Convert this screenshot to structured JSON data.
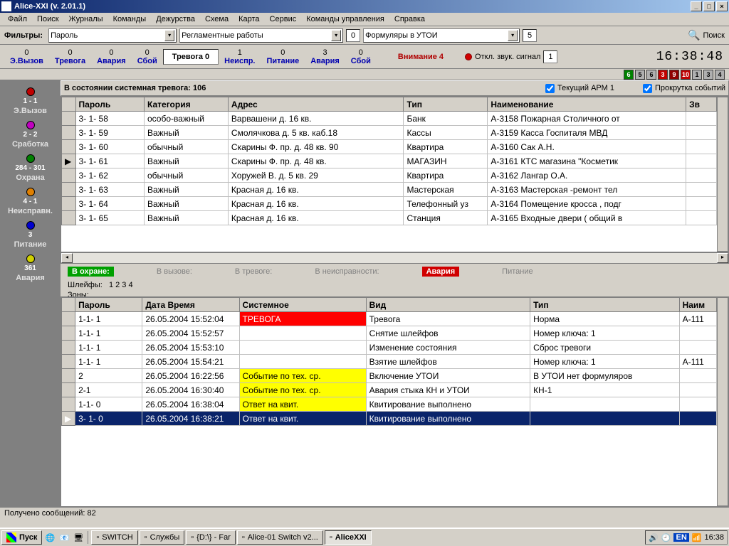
{
  "title": "Alice-XXI (v. 2.01.1)",
  "menu": [
    "Файл",
    "Поиск",
    "Журналы",
    "Команды",
    "Дежурства",
    "Схема",
    "Карта",
    "Сервис",
    "Команды управления",
    "Справка"
  ],
  "filters": {
    "label": "Фильтры:",
    "combo1": "Пароль",
    "combo2": "Регламентные работы",
    "num2": "0",
    "combo3": "Формуляры в УТОИ",
    "num3": "5",
    "search": "Поиск"
  },
  "counters": {
    "left": [
      {
        "num": "0",
        "lbl": "Э.Вызов"
      },
      {
        "num": "0",
        "lbl": "Тревога"
      },
      {
        "num": "0",
        "lbl": "Авария"
      },
      {
        "num": "0",
        "lbl": "Сбой"
      }
    ],
    "trev": "Тревога 0",
    "right": [
      {
        "num": "1",
        "lbl": "Неиспр."
      },
      {
        "num": "0",
        "lbl": "Питание"
      },
      {
        "num": "3",
        "lbl": "Авария"
      },
      {
        "num": "0",
        "lbl": "Сбой"
      }
    ],
    "attention": "Внимание 4",
    "sound": "Откл. звук. сигнал",
    "soundn": "1",
    "clock": "16:38:48"
  },
  "cboxes": [
    {
      "n": "6",
      "c": "#008000"
    },
    {
      "n": "5",
      "c": "#b0b0b0"
    },
    {
      "n": "6",
      "c": "#b0b0b0"
    },
    {
      "n": "3",
      "c": "#c00000"
    },
    {
      "n": "9",
      "c": "#900000"
    },
    {
      "n": "10",
      "c": "#c00000"
    },
    {
      "n": "1",
      "c": "#b0b0b0"
    },
    {
      "n": "3",
      "c": "#b0b0b0"
    },
    {
      "n": "4",
      "c": "#b0b0b0"
    }
  ],
  "left_items": [
    {
      "dot": "#c00000",
      "cnt": "1 - 1",
      "lbl": "Э.Вызов"
    },
    {
      "dot": "#c000c0",
      "cnt": "2 - 2",
      "lbl": "Сработка"
    },
    {
      "dot": "#008000",
      "cnt": "284 - 301",
      "lbl": "Охрана"
    },
    {
      "dot": "#e08000",
      "cnt": "4 - 1",
      "lbl": "Неисправн."
    },
    {
      "dot": "#0000d0",
      "cnt": "3",
      "lbl": "Питание"
    },
    {
      "dot": "#d0d000",
      "cnt": "361",
      "lbl": "Авария"
    }
  ],
  "panel1": {
    "title": "В состоянии системная тревога: 106",
    "chk1": "Текущий АРМ 1",
    "chk2": "Прокрутка событий"
  },
  "table1": {
    "headers": [
      "Пароль",
      "Категория",
      "Адрес",
      "Тип",
      "Наименование",
      "Зв"
    ],
    "rows": [
      [
        "3- 1- 58",
        "особо-важный",
        "Варвашени  д. 16 кв.",
        "Банк",
        "А-3158 Пожарная Столичного от"
      ],
      [
        "3- 1- 59",
        "Важный",
        "Смолячкова  д. 5 кв. каб.18",
        "Кассы",
        "А-3159 Касса Госпиталя МВД"
      ],
      [
        "3- 1- 60",
        "обычный",
        "Скарины Ф. пр.  д. 48 кв. 90",
        "Квартира",
        "А-3160 Сак А.Н."
      ],
      [
        "3- 1- 61",
        "Важный",
        "Скарины Ф. пр.  д. 48 кв.",
        "МАГАЗИН",
        "А-3161 КТС магазина \"Косметик"
      ],
      [
        "3- 1- 62",
        "обычный",
        "Хоружей В.  д. 5 кв. 29",
        "Квартира",
        "А-3162 Лангар О.А."
      ],
      [
        "3- 1- 63",
        "Важный",
        "Красная  д. 16 кв.",
        "Мастерская",
        "А-3163 Мастерская -ремонт тел"
      ],
      [
        "3- 1- 64",
        "Важный",
        "Красная  д. 16 кв.",
        "Телефонный уз",
        "А-3164 Помещение кросса , подг"
      ],
      [
        "3- 1- 65",
        "Важный",
        "Красная  д. 16 кв.",
        "Станция",
        "А-3165 Входные двери ( общий в"
      ]
    ],
    "current_row": 3
  },
  "mid": {
    "ohrane": "В охране:",
    "vyzove": "В вызове:",
    "trevoge": "В тревоге:",
    "neispr": "В неисправности:",
    "avaria": "Авария",
    "pitanie": "Питание",
    "shleyf_lbl": "Шлейфы:",
    "shleyf": "1   2   3   4",
    "zony_lbl": "Зоны:"
  },
  "table2": {
    "headers": [
      "Пароль",
      "Дата Время",
      "Системное",
      "Вид",
      "Тип",
      "Наим"
    ],
    "rows": [
      {
        "c": [
          "1-1- 1",
          "26.05.2004 15:52:04",
          "ТРЕВОГА",
          "Тревога",
          "Норма",
          "А-111"
        ],
        "sys": "red"
      },
      {
        "c": [
          "1-1- 1",
          "26.05.2004 15:52:57",
          "",
          "Снятие шлейфов",
          "Номер ключа: 1",
          ""
        ],
        "sys": ""
      },
      {
        "c": [
          "1-1- 1",
          "26.05.2004 15:53:10",
          "",
          "Изменение состояния",
          "Сброс тревоги",
          ""
        ],
        "sys": ""
      },
      {
        "c": [
          "1-1- 1",
          "26.05.2004 15:54:21",
          "",
          "Взятие шлейфов",
          "Номер ключа: 1",
          "А-111"
        ],
        "sys": ""
      },
      {
        "c": [
          "2",
          "26.05.2004 16:22:56",
          "Событие по тех. ср.",
          "Включение УТОИ",
          "В УТОИ нет формуляров",
          ""
        ],
        "sys": "yellow"
      },
      {
        "c": [
          "2-1",
          "26.05.2004 16:30:40",
          "Событие по тех. ср.",
          "Авария стыка КН и УТОИ",
          "КН-1",
          ""
        ],
        "sys": "yellow"
      },
      {
        "c": [
          "1-1- 0",
          "26.05.2004 16:38:04",
          "Ответ на квит.",
          "Квитирование выполнено",
          "",
          ""
        ],
        "sys": "yellow"
      },
      {
        "c": [
          "3- 1-  0",
          "26.05.2004 16:38:21",
          "Ответ на квит.",
          "Квитирование выполнено",
          "",
          ""
        ],
        "sys": "",
        "sel": true
      }
    ]
  },
  "statusbar": "Получено сообщений: 82",
  "taskbar": {
    "start": "Пуск",
    "tasks": [
      {
        "t": "SWITCH",
        "a": false
      },
      {
        "t": "Службы",
        "a": false
      },
      {
        "t": "{D:\\} - Far",
        "a": false
      },
      {
        "t": "Alice-01 Switch v2...",
        "a": false
      },
      {
        "t": "AliceXXI",
        "a": true
      }
    ],
    "time": "16:38",
    "lang": "EN"
  }
}
